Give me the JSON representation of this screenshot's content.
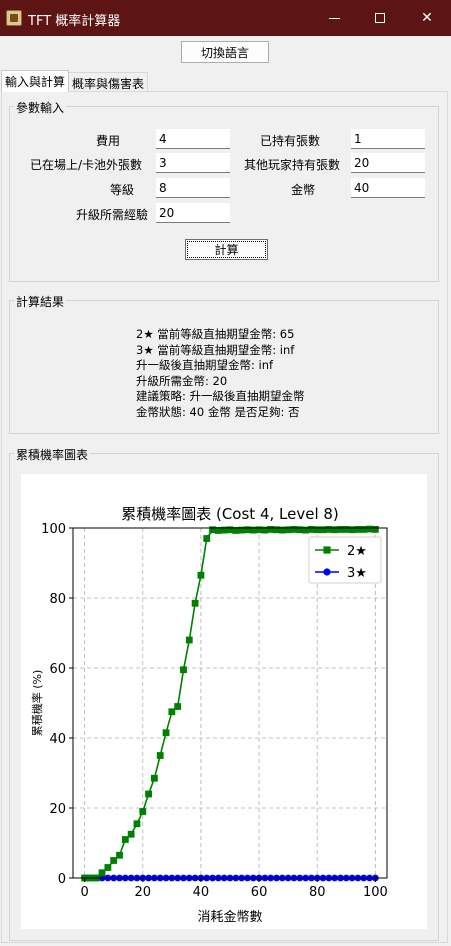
{
  "window": {
    "title": "TFT 概率計算器",
    "app_icon": "app-icon"
  },
  "toolbar": {
    "switch_language": "切換語言"
  },
  "tabs": [
    {
      "label": "輸入與計算",
      "active": true
    },
    {
      "label": "概率與傷害表",
      "active": false
    }
  ],
  "params": {
    "title": "參數輸入",
    "cost": {
      "label": "費用",
      "value": "4"
    },
    "owned": {
      "label": "已持有張數",
      "value": "1"
    },
    "out_of_pool": {
      "label": "已在場上/卡池外張數",
      "value": "3"
    },
    "others_owned": {
      "label": "其他玩家持有張數",
      "value": "20"
    },
    "level": {
      "label": "等級",
      "value": "8"
    },
    "gold": {
      "label": "金幣",
      "value": "40"
    },
    "xp_needed": {
      "label": "升級所需經驗",
      "value": "20"
    },
    "calculate": "計算"
  },
  "results": {
    "title": "計算結果",
    "lines": [
      "2★ 當前等級直抽期望金幣: 65",
      "3★ 當前等級直抽期望金幣: inf",
      "升一級後直抽期望金幣: inf",
      "升級所需金幣: 20",
      "建議策略: 升一級後直抽期望金幣",
      "金幣狀態: 40 金幣 是否足夠: 否"
    ]
  },
  "chart_section": {
    "title": "累積機率圖表"
  },
  "chart_data": {
    "type": "line",
    "title": "累積機率圖表 (Cost 4, Level 8)",
    "xlabel": "消耗金幣數",
    "ylabel": "累積機率 (%)",
    "xlim": [
      -4,
      104
    ],
    "ylim": [
      0,
      100
    ],
    "xticks": [
      0,
      20,
      40,
      60,
      80,
      100
    ],
    "yticks": [
      0,
      20,
      40,
      60,
      80,
      100
    ],
    "grid": true,
    "legend_position": "top-right",
    "x": [
      0,
      2,
      4,
      6,
      8,
      10,
      12,
      14,
      16,
      18,
      20,
      22,
      24,
      26,
      28,
      30,
      32,
      34,
      36,
      38,
      40,
      42,
      44,
      46,
      48,
      50,
      52,
      54,
      56,
      58,
      60,
      62,
      64,
      66,
      68,
      70,
      72,
      74,
      76,
      78,
      80,
      82,
      84,
      86,
      88,
      90,
      92,
      94,
      96,
      98,
      100
    ],
    "series": [
      {
        "name": "3★",
        "color": "#0000ff",
        "marker": "circle",
        "values": [
          0,
          0,
          0,
          0,
          0,
          0,
          0,
          0,
          0,
          0,
          0,
          0,
          0,
          0,
          0,
          0,
          0,
          0,
          0,
          0,
          0,
          0,
          0,
          0,
          0,
          0,
          0,
          0,
          0,
          0,
          0,
          0,
          0,
          0,
          0,
          0,
          0,
          0,
          0,
          0,
          0,
          0,
          0,
          0,
          0,
          0,
          0,
          0,
          0,
          0,
          0
        ]
      },
      {
        "name": "2★",
        "color": "#008000",
        "marker": "square",
        "values": [
          0,
          0,
          0,
          1.5,
          3,
          5,
          6.5,
          11,
          12.5,
          15.5,
          19,
          24,
          28.5,
          35,
          41.5,
          47.5,
          49,
          59.5,
          68,
          78.5,
          86.5,
          97,
          99.5,
          99.3,
          99.4,
          99.5,
          99.3,
          99.4,
          99.5,
          99.4,
          99.5,
          99.4,
          99.6,
          99.5,
          99.4,
          99.5,
          99.6,
          99.5,
          99.4,
          99.6,
          99.5,
          99.5,
          99.6,
          99.5,
          99.6,
          99.6,
          99.5,
          99.6,
          99.6,
          99.7,
          99.6
        ]
      }
    ]
  }
}
